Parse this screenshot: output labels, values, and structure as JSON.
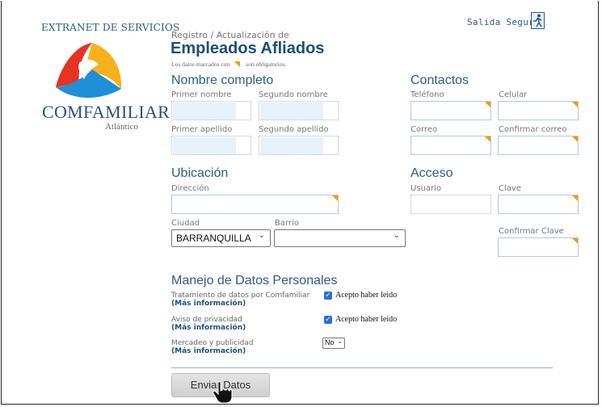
{
  "sidebar": {
    "title": "EXTRANET DE SERVICIOS",
    "logo_text": "COMFAMILIAR",
    "logo_sub": "Atlántico"
  },
  "header": {
    "subtitle": "Registro / Actualización de",
    "title": "Empleados Afliados",
    "required_note_prefix": "Los datos marcados con",
    "required_note_suffix": "son obligatorios.",
    "safe_exit": "Salida Segura"
  },
  "sections": {
    "nombre": "Nombre completo",
    "contactos": "Contactos",
    "ubicacion": "Ubicación",
    "acceso": "Acceso",
    "datos": "Manejo de Datos Personales"
  },
  "labels": {
    "primer_nombre": "Primer nombre",
    "segundo_nombre": "Segundo nombre",
    "primer_apellido": "Primer apellido",
    "segundo_apellido": "Segundo apellido",
    "telefono": "Teléfono",
    "celular": "Celular",
    "correo": "Correo",
    "confirmar_correo": "Confirmar correo",
    "direccion": "Dirección",
    "usuario": "Usuario",
    "clave": "Clave",
    "ciudad": "Ciudad",
    "barrio": "Barrio",
    "confirmar_clave": "Confirmar Clave"
  },
  "selects": {
    "ciudad_value": "BARRANQUILLA",
    "barrio_value": "",
    "mercadeo_value": "No"
  },
  "datos": {
    "tratamiento": "Tratamiento de datos por Comfamiliar",
    "aviso": "Aviso de privacidad",
    "mercadeo": "Mercadeo y publicidad",
    "mas_info": "(Más información)",
    "acepto": "Acepto haber leido"
  },
  "button": {
    "enviar": "Enviar Datos"
  },
  "colors": {
    "accent": "#2d5c8a",
    "required_mark": "#f39a0e",
    "title": "#1f4d7a"
  }
}
